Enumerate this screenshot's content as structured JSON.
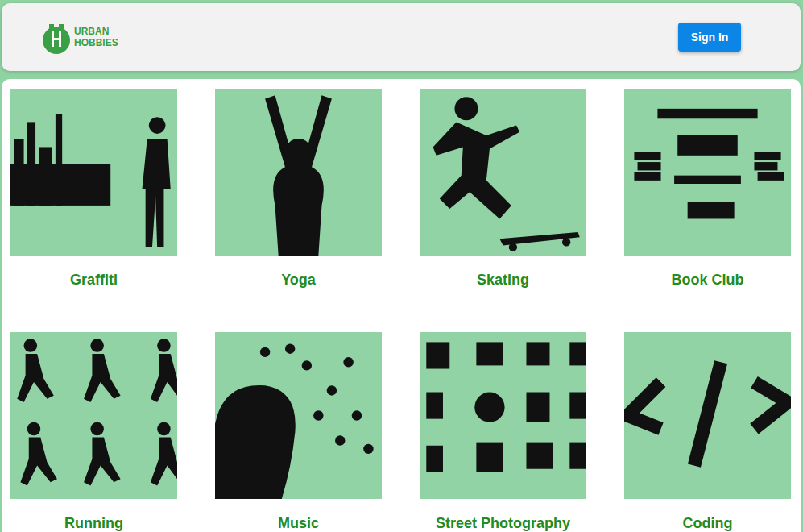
{
  "header": {
    "logo": {
      "line1": "URBAN",
      "line2": "HOBBIES"
    },
    "sign_in": "Sign In"
  },
  "hobbies": [
    {
      "name": "Graffiti"
    },
    {
      "name": "Yoga"
    },
    {
      "name": "Skating"
    },
    {
      "name": "Book Club"
    },
    {
      "name": "Running"
    },
    {
      "name": "Music"
    },
    {
      "name": "Street Photography"
    },
    {
      "name": "Coding"
    }
  ]
}
